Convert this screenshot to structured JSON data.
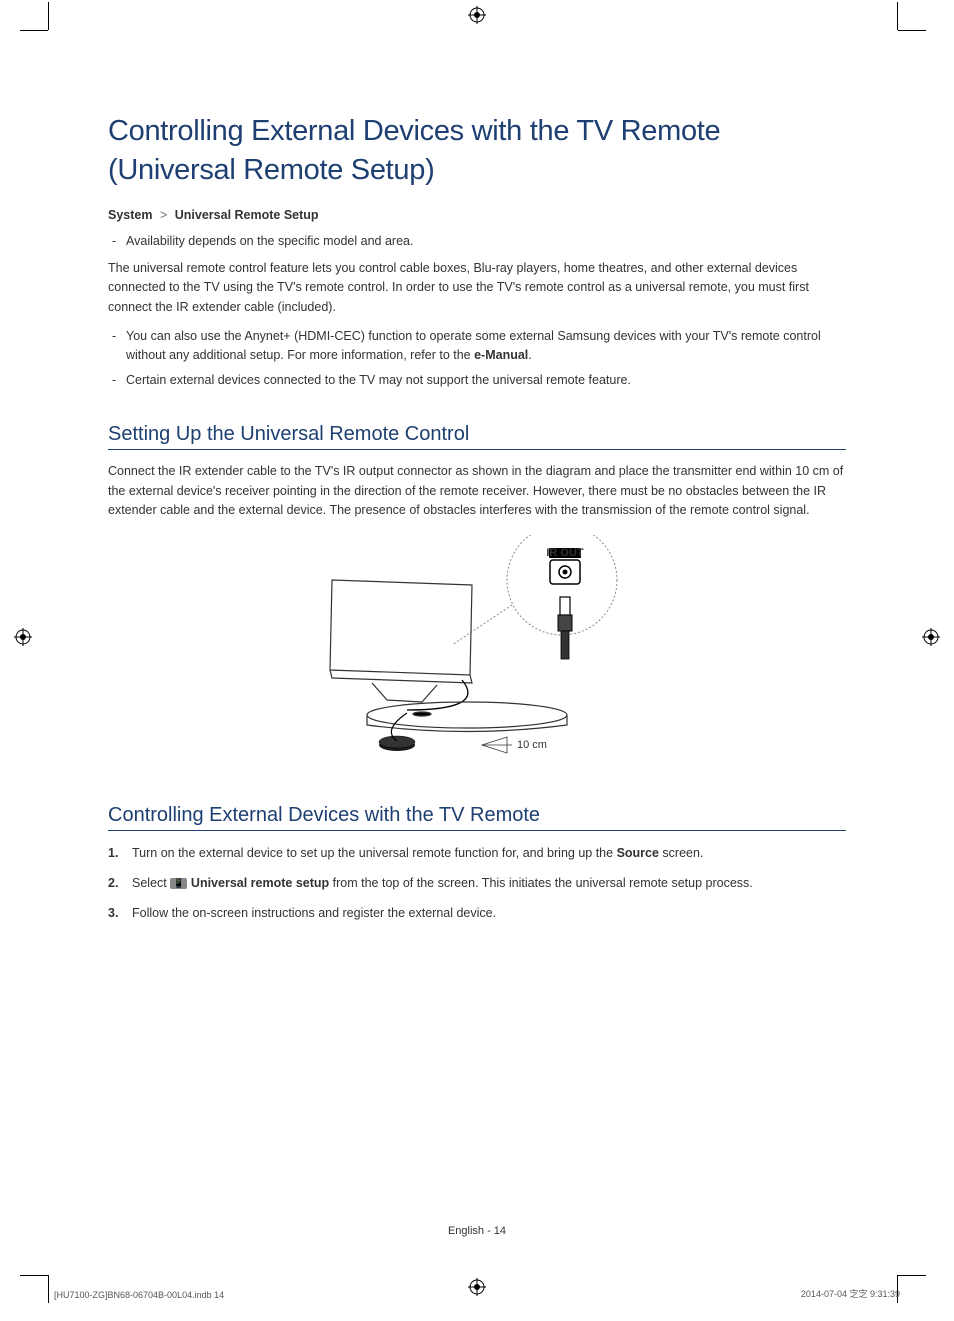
{
  "title": "Controlling External Devices with the TV Remote (Universal Remote Setup)",
  "breadcrumb": {
    "a": "System",
    "b": "Universal Remote Setup"
  },
  "notes1": [
    "Availability depends on the specific model and area."
  ],
  "intro": "The universal remote control feature lets you control cable boxes, Blu-ray players, home theatres, and other external devices connected to the TV using the TV's remote control. In order to use the TV's remote control as a universal remote, you must first connect the IR extender cable (included).",
  "notes2_a_pre": "You can also use the Anynet+ (HDMI-CEC) function to operate some external Samsung devices with your TV's remote control without any additional setup. For more information, refer to the ",
  "notes2_a_bold": "e-Manual",
  "notes2_a_post": ".",
  "notes2_b": "Certain external devices connected to the TV may not support the universal remote feature.",
  "section1_title": "Setting Up the Universal Remote Control",
  "section1_body": "Connect the IR extender cable to the TV's IR output connector as shown in the diagram and place the transmitter end within 10 cm of the external device's receiver pointing in the direction of the remote receiver. However, there must be no obstacles between the IR extender cable and the external device. The presence of obstacles interferes with the transmission of the remote control signal.",
  "diagram": {
    "ir_out_label": "IR OUT",
    "distance": "10 cm"
  },
  "section2_title": "Controlling External Devices with the TV Remote",
  "steps": {
    "s1_pre": "Turn on the external device to set up the universal remote function for, and bring up the ",
    "s1_bold": "Source",
    "s1_post": " screen.",
    "s2_pre": "Select ",
    "s2_bold": "Universal remote setup",
    "s2_post": " from the top of the screen. This initiates the universal remote setup process.",
    "s3": "Follow the on-screen instructions and register the external device."
  },
  "footer_page": "English - 14",
  "footer_left": "[HU7100-ZG]BN68-06704B-00L04.indb   14",
  "footer_right": "2014-07-04   㝎㝎 9:31:39"
}
